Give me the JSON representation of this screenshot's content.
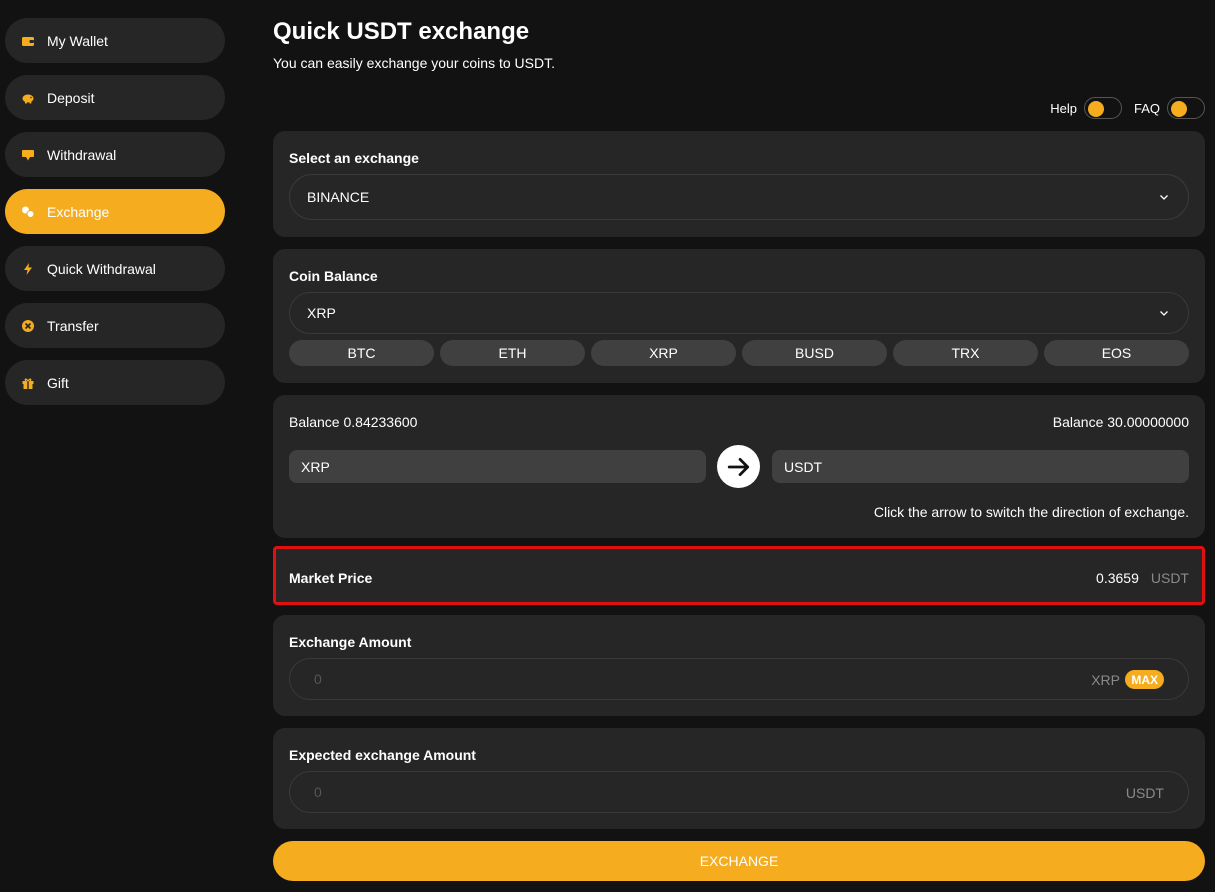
{
  "sidebar": {
    "items": [
      {
        "label": "My Wallet",
        "icon": "wallet-icon"
      },
      {
        "label": "Deposit",
        "icon": "piggy-bank-icon"
      },
      {
        "label": "Withdrawal",
        "icon": "withdrawal-icon"
      },
      {
        "label": "Exchange",
        "icon": "exchange-icon",
        "active": true
      },
      {
        "label": "Quick Withdrawal",
        "icon": "lightning-icon"
      },
      {
        "label": "Transfer",
        "icon": "transfer-icon"
      },
      {
        "label": "Gift",
        "icon": "gift-icon"
      }
    ]
  },
  "header": {
    "title": "Quick USDT exchange",
    "subtitle": "You can easily exchange your coins to USDT."
  },
  "toggles": {
    "help_label": "Help",
    "faq_label": "FAQ"
  },
  "exchange_select": {
    "label": "Select an exchange",
    "value": "BINANCE"
  },
  "coin_balance": {
    "label": "Coin Balance",
    "value": "XRP",
    "chips": [
      "BTC",
      "ETH",
      "XRP",
      "BUSD",
      "TRX",
      "EOS"
    ]
  },
  "swap": {
    "from_balance": "Balance 0.84233600",
    "to_balance": "Balance 30.00000000",
    "from_coin": "XRP",
    "to_coin": "USDT",
    "hint": "Click the arrow to switch the direction of exchange."
  },
  "market_price": {
    "label": "Market Price",
    "value": "0.3659",
    "unit": "USDT"
  },
  "exchange_amount": {
    "label": "Exchange Amount",
    "placeholder": "0",
    "unit": "XRP",
    "max_label": "MAX"
  },
  "expected_amount": {
    "label": "Expected exchange Amount",
    "placeholder": "0",
    "unit": "USDT"
  },
  "exchange_button": {
    "label": "EXCHANGE"
  },
  "colors": {
    "accent": "#f5ac1e",
    "card": "#262626",
    "background": "#121212",
    "highlight_border": "#e01010"
  }
}
